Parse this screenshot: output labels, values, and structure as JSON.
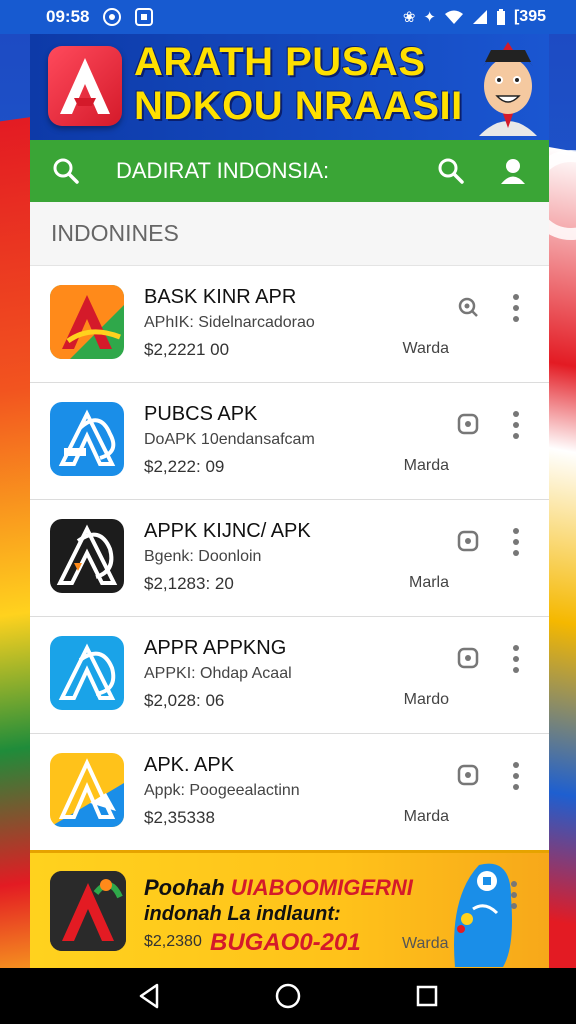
{
  "status_bar": {
    "time": "09:58",
    "battery_text": "[395"
  },
  "banner": {
    "title_line1": "ARATH PUSAS",
    "title_line2": "NDKOU NRAASII"
  },
  "app_bar": {
    "title": "DADIRAT INDONSIA:"
  },
  "section": {
    "header": "INDONINES"
  },
  "apps": [
    {
      "name": "BASK KINR APR",
      "subtitle": "APhIK: Sidelnarcadorao",
      "price": "$2,2221 00",
      "status": "Warda",
      "action_icon": "search-circle-icon"
    },
    {
      "name": "PUBCS APK",
      "subtitle": "DoAPK 10endansafcam",
      "price": "$2,222: 09",
      "status": "Marda",
      "action_icon": "square-icon"
    },
    {
      "name": "APPK KIJNC/ APK",
      "subtitle": "Bgenk: Doonloin",
      "price": "$2,1283: 20",
      "status": "Marla",
      "action_icon": "square-icon"
    },
    {
      "name": "APPR APPKNG",
      "subtitle": "APPKI: Ohdap Acaal",
      "price": "$2,028: 06",
      "status": "Mardo",
      "action_icon": "square-icon"
    },
    {
      "name": "APK. APK",
      "subtitle": "Appk: Poogeealactinn",
      "price": "$2,35338",
      "status": "Marda",
      "action_icon": "square-icon"
    }
  ],
  "promo": {
    "title_prefix": "Poohah ",
    "title_highlight": "UIABOOMIGERNI",
    "subtitle": "indonah La indlaunt:",
    "price": "$2,2380",
    "code": "BUGAO0-201",
    "status": "Warda"
  },
  "colors": {
    "status_bar": "#175ad0",
    "banner_title": "#ffe000",
    "app_bar": "#3aa536",
    "promo_bg": "#ffd21e",
    "promo_accent": "#d41a2a"
  }
}
